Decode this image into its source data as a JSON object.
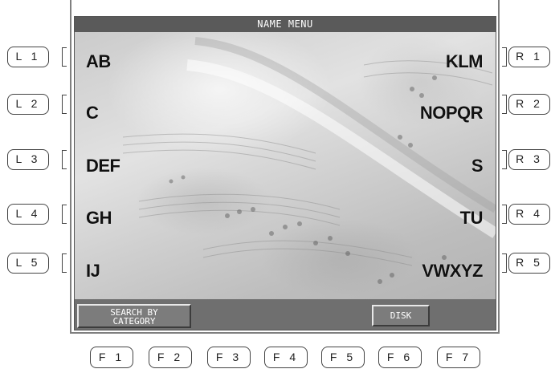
{
  "screen": {
    "title": "NAME MENU",
    "left_items": [
      "AB",
      "C",
      "DEF",
      "GH",
      "IJ"
    ],
    "right_items": [
      "KLM",
      "NOPQR",
      "S",
      "TU",
      "VWXYZ"
    ],
    "search_by_category": [
      "SEARCH BY",
      "CATEGORY"
    ],
    "disk_label": "DISK"
  },
  "hardware": {
    "left_buttons": [
      "L 1",
      "L 2",
      "L 3",
      "L 4",
      "L 5"
    ],
    "right_buttons": [
      "R 1",
      "R 2",
      "R 3",
      "R 4",
      "R 5"
    ],
    "function_buttons": [
      "F 1",
      "F 2",
      "F 3",
      "F 4",
      "F 5",
      "F 6",
      "F 7"
    ]
  }
}
